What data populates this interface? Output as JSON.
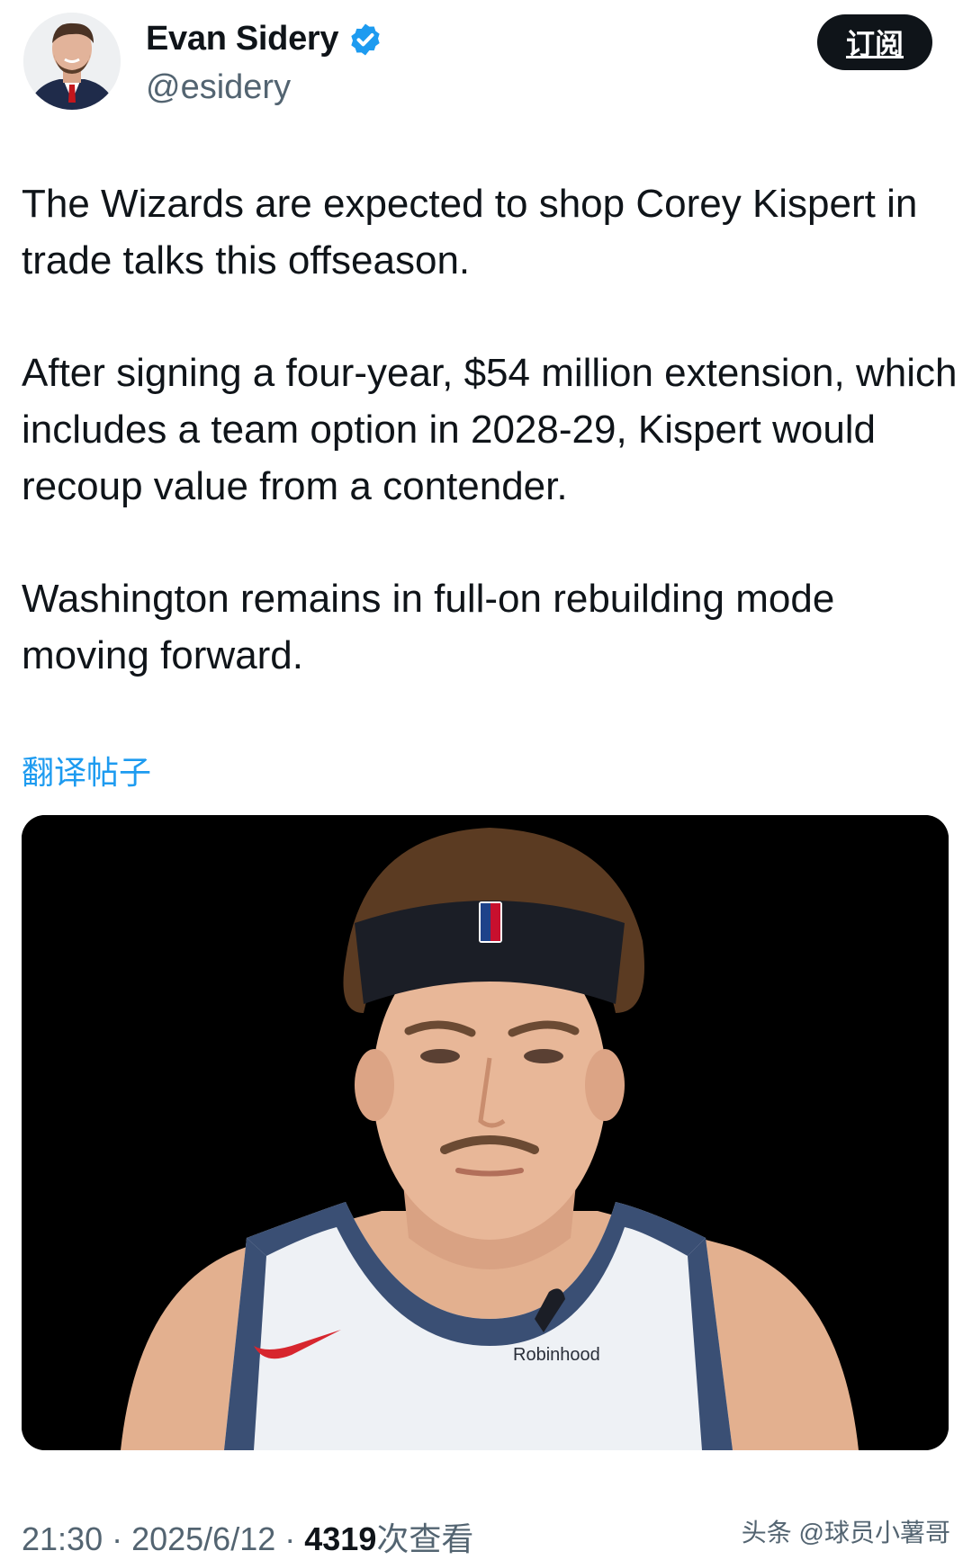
{
  "author": {
    "display_name": "Evan Sidery",
    "handle": "@esidery",
    "verified_icon": "verified-badge-icon",
    "verified_color": "#1d9bf0"
  },
  "subscribe_button": {
    "label": "订阅"
  },
  "tweet": {
    "paragraphs": [
      "The Wizards are expected to shop Corey Kispert in trade talks this offseason.",
      "After signing a four-year, $54 million extension, which includes a team option in 2028-29, Kispert would recoup value from a contender.",
      "Washington remains in full-on rebuilding mode moving forward."
    ]
  },
  "translate_link": {
    "label": "翻译帖子"
  },
  "media": {
    "jersey_sponsor": "Robinhood",
    "headband_logo": "NBA"
  },
  "footer": {
    "time": "21:30",
    "separator": " · ",
    "date": "2025/6/12",
    "views_count": "4319",
    "views_label": "次查看",
    "watermark": "头条 @球员小薯哥"
  },
  "colors": {
    "link": "#1d9bf0",
    "text": "#0f1419",
    "secondary": "#536471"
  }
}
